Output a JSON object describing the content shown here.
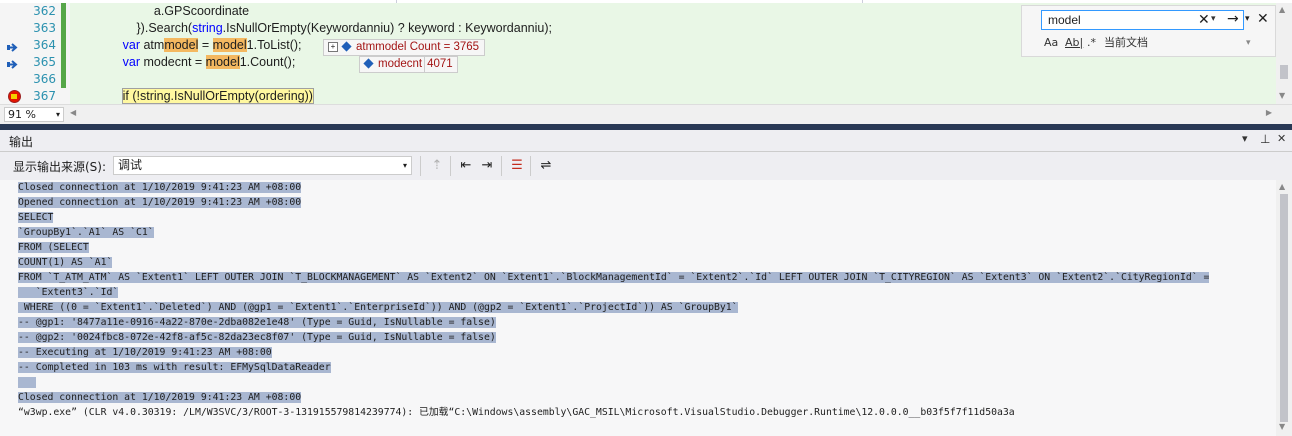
{
  "editor": {
    "lines": [
      {
        "num": "362",
        "segments": [
          {
            "t": "                       a.GPScoordinate",
            "c": ""
          }
        ]
      },
      {
        "num": "363",
        "segments": [
          {
            "t": "                  }).Search(",
            "c": ""
          },
          {
            "t": "string",
            "c": "kw"
          },
          {
            "t": ".IsNullOrEmpty(Keywordanniu) ? keyword : Keywordanniu);",
            "c": ""
          }
        ]
      },
      {
        "num": "364",
        "segments": [
          {
            "t": "              ",
            "c": ""
          },
          {
            "t": "var",
            "c": "kw"
          },
          {
            "t": " atm",
            "c": ""
          },
          {
            "t": "model",
            "c": "hl"
          },
          {
            "t": " = ",
            "c": ""
          },
          {
            "t": "model",
            "c": "hl"
          },
          {
            "t": "1.ToList();",
            "c": ""
          }
        ]
      },
      {
        "num": "365",
        "segments": [
          {
            "t": "              ",
            "c": ""
          },
          {
            "t": "var",
            "c": "kw"
          },
          {
            "t": " modecnt = ",
            "c": ""
          },
          {
            "t": "model",
            "c": "hl"
          },
          {
            "t": "1.Count();",
            "c": ""
          }
        ]
      },
      {
        "num": "366",
        "segments": []
      },
      {
        "num": "367",
        "segments": [
          {
            "t": "              ",
            "c": ""
          },
          {
            "t": "if (!string.IsNullOrEmpty(ordering))",
            "c": "cur"
          }
        ]
      }
    ],
    "datatips": [
      {
        "expand": "+",
        "name": "atmmodel",
        "value": "Count = 3765"
      },
      {
        "expand": "",
        "name": "modecnt",
        "value": "4071"
      }
    ],
    "find": {
      "value": "model",
      "clear": "✕",
      "dropdown": "▾",
      "next": "→",
      "options": "▾",
      "close": "✕",
      "match_case": "Aa",
      "whole_word": "A͟b͟|",
      "regex": ".*",
      "scope": "当前文档",
      "scope_drop": "▾"
    },
    "zoom": "91 %",
    "zoom_drop": "▾",
    "scroll_up": "▲",
    "scroll_down": "▼",
    "scroll_left": "◀",
    "scroll_right": "▶"
  },
  "output": {
    "title": "输出",
    "title_dropdown": "▾",
    "title_pin": "ᵖ",
    "title_close": "✕",
    "source_label": "显示输出来源(S):",
    "source_value": "调试",
    "source_drop": "▾",
    "toolbar_icons": [
      "find-message-icon",
      "prev-message-icon",
      "next-message-icon",
      "clear-all-icon",
      "word-wrap-icon"
    ],
    "lines": [
      {
        "t": "Closed connection at 1/10/2019 9:41:23 AM +08:00",
        "sel": true
      },
      {
        "t": "Opened connection at 1/10/2019 9:41:23 AM +08:00",
        "sel": true
      },
      {
        "t": "SELECT",
        "sel": true
      },
      {
        "t": "`GroupBy1`.`A1` AS `C1`",
        "sel": true
      },
      {
        "t": "FROM (SELECT",
        "sel": true
      },
      {
        "t": "COUNT(1) AS `A1`",
        "sel": true
      },
      {
        "t": "FROM `T_ATM_ATM` AS `Extent1` LEFT OUTER JOIN `T_BLOCKMANAGEMENT` AS `Extent2` ON `Extent1`.`BlockManagementId` = `Extent2`.`Id` LEFT OUTER JOIN `T_CITYREGION` AS `Extent3` ON `Extent2`.`CityRegionId` =",
        "sel": true
      },
      {
        "t": "   `Extent3`.`Id`",
        "sel": true
      },
      {
        "t": " WHERE ((0 = `Extent1`.`Deleted`) AND (@gp1 = `Extent1`.`EnterpriseId`)) AND (@gp2 = `Extent1`.`ProjectId`)) AS `GroupBy1`",
        "sel": true
      },
      {
        "t": "-- @gp1: '8477a11e-0916-4a22-870e-2dba082e1e48' (Type = Guid, IsNullable = false)",
        "sel": true
      },
      {
        "t": "-- @gp2: '0024fbc8-072e-42f8-af5c-82da23ec8f07' (Type = Guid, IsNullable = false)",
        "sel": true
      },
      {
        "t": "-- Executing at 1/10/2019 9:41:23 AM +08:00",
        "sel": true
      },
      {
        "t": "-- Completed in 103 ms with result: EFMySqlDataReader",
        "sel": true
      },
      {
        "t": "   ",
        "sel": true
      },
      {
        "t": "Closed connection at 1/10/2019 9:41:23 AM +08:00",
        "sel": true
      },
      {
        "t": "“w3wp.exe” (CLR v4.0.30319: /LM/W3SVC/3/ROOT-3-131915579814239774): 已加载“C:\\Windows\\assembly\\GAC_MSIL\\Microsoft.VisualStudio.Debugger.Runtime\\12.0.0.0__b03f5f7f11d50a3a",
        "sel": false
      }
    ]
  },
  "colors": {
    "accent": "#3399ff",
    "selection": "#a9b7d1",
    "changed": "#57a64a",
    "highlight": "#f4b860"
  }
}
